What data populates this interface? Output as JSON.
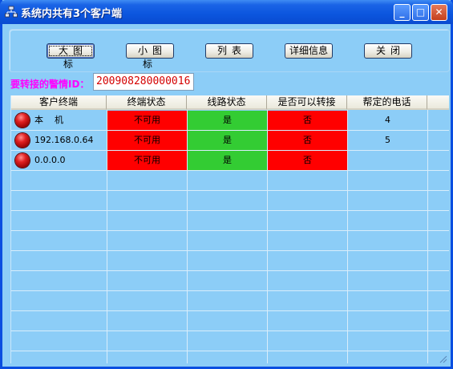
{
  "window": {
    "title": "系统内共有3个客户端",
    "minimize_label": "_",
    "maximize_label": "□",
    "close_label": "✕"
  },
  "toolbar": {
    "large_icons": "大图标",
    "small_icons": "小图标",
    "list": "列表",
    "details": "详细信息",
    "close": "关闭"
  },
  "alarm": {
    "label": "要转接的警情ID：",
    "value": "200908280000016"
  },
  "table": {
    "headers": [
      "客户终端",
      "终端状态",
      "线路状态",
      "是否可以转接",
      "帮定的电话"
    ],
    "rows": [
      {
        "client": "本    机",
        "terminal": "不可用",
        "line": "是",
        "transfer": "否",
        "phone": "4"
      },
      {
        "client": "192.168.0.64",
        "terminal": "不可用",
        "line": "是",
        "transfer": "否",
        "phone": "5"
      },
      {
        "client": "0.0.0.0",
        "terminal": "不可用",
        "line": "是",
        "transfer": "否",
        "phone": ""
      }
    ]
  },
  "colors": {
    "unavailable": "#ff0000",
    "yes": "#33cc33",
    "no": "#ff0000",
    "background": "#8ccdf7",
    "id_text": "#d40000",
    "label_text": "#ff00ff"
  },
  "icons": {
    "app": "network-icon",
    "status": "red-ball-icon"
  }
}
